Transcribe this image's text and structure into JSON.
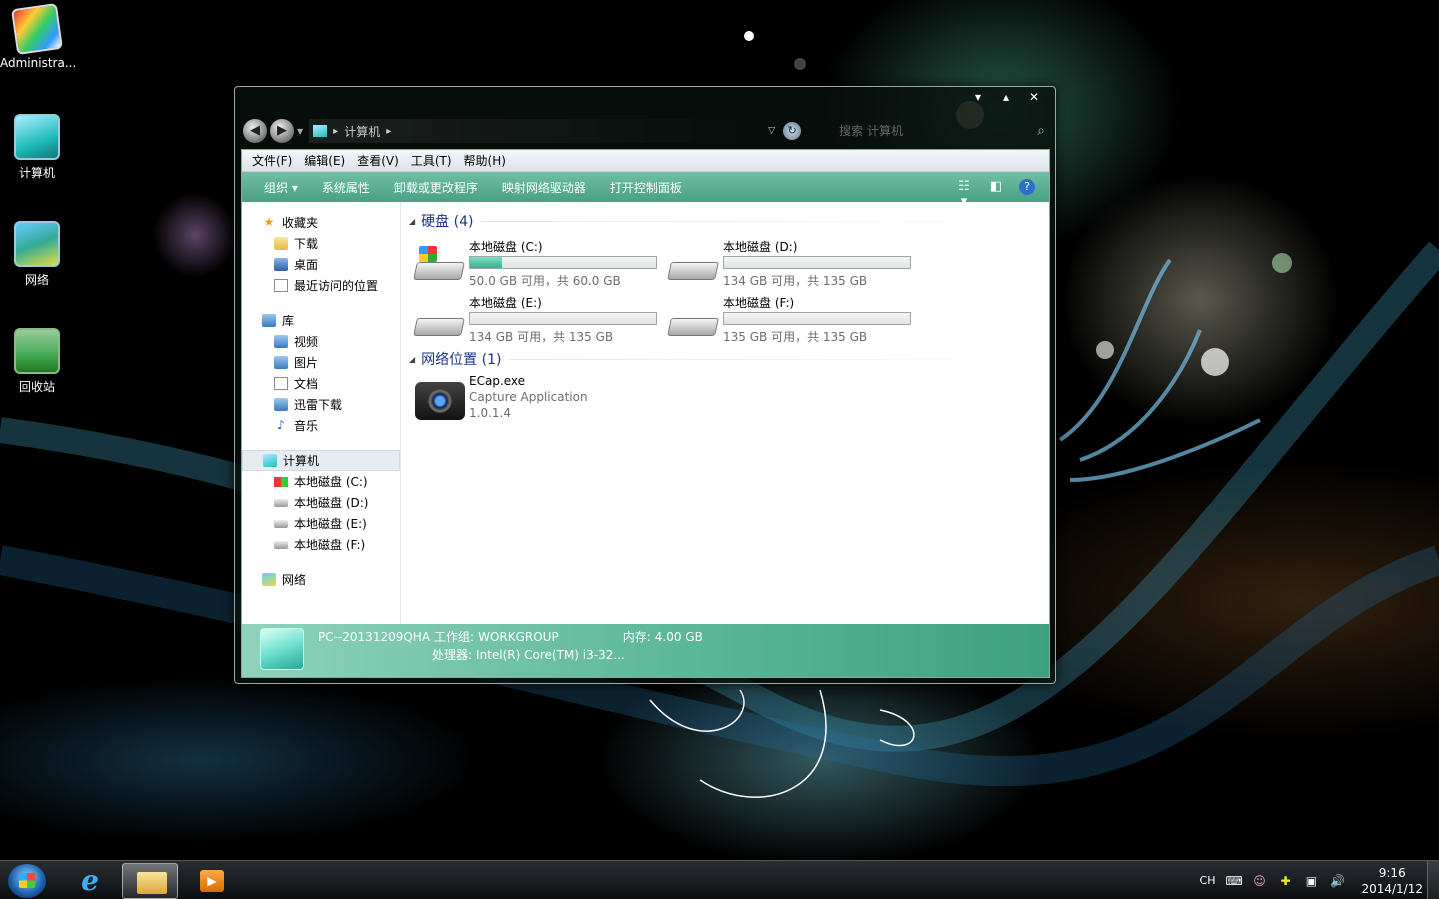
{
  "desktop": {
    "icons": [
      {
        "label": "Administra...",
        "icon": "user-folder-icon"
      },
      {
        "label": "计算机",
        "icon": "computer-icon"
      },
      {
        "label": "网络",
        "icon": "network-icon"
      },
      {
        "label": "回收站",
        "icon": "recycle-bin-icon"
      }
    ]
  },
  "window": {
    "controls": {
      "minimize": "▾",
      "maximize": "▴",
      "close": "✕"
    },
    "address": {
      "crumb": "计算机",
      "separator": "▸"
    },
    "search": {
      "placeholder": "搜索 计算机"
    },
    "menubar": [
      "文件(F)",
      "编辑(E)",
      "查看(V)",
      "工具(T)",
      "帮助(H)"
    ],
    "toolbar": {
      "organize": "组织 ▾",
      "items": [
        "系统属性",
        "卸载或更改程序",
        "映射网络驱动器",
        "打开控制面板"
      ]
    },
    "nav": {
      "favorites": {
        "label": "收藏夹",
        "items": [
          "下载",
          "桌面",
          "最近访问的位置"
        ]
      },
      "libraries": {
        "label": "库",
        "items": [
          "视频",
          "图片",
          "文档",
          "迅雷下载",
          "音乐"
        ]
      },
      "computer": {
        "label": "计算机",
        "items": [
          "本地磁盘 (C:)",
          "本地磁盘 (D:)",
          "本地磁盘 (E:)",
          "本地磁盘 (F:)"
        ]
      },
      "network": {
        "label": "网络"
      }
    },
    "content": {
      "hard_disks_header": "硬盘 (4)",
      "drives": [
        {
          "name": "本地磁盘 (C:)",
          "info": "50.0 GB 可用，共 60.0 GB",
          "used_fraction": 0.17,
          "system": true
        },
        {
          "name": "本地磁盘 (D:)",
          "info": "134 GB 可用，共 135 GB",
          "used_fraction": 0.0,
          "system": false
        },
        {
          "name": "本地磁盘 (E:)",
          "info": "134 GB 可用，共 135 GB",
          "used_fraction": 0.0,
          "system": false
        },
        {
          "name": "本地磁盘 (F:)",
          "info": "135 GB 可用，共 135 GB",
          "used_fraction": 0.0,
          "system": false
        }
      ],
      "network_header": "网络位置 (1)",
      "app": {
        "name": "ECap.exe",
        "description": "Capture Application",
        "version": "1.0.1.4"
      }
    },
    "details": {
      "computer_name": "PC--20131209QHA",
      "workgroup_label": "工作组:",
      "workgroup": "WORKGROUP",
      "memory_label": "内存:",
      "memory": "4.00 GB",
      "processor_label": "处理器:",
      "processor": "Intel(R) Core(TM) i3-32..."
    }
  },
  "taskbar": {
    "language": "CH",
    "time": "9:16",
    "date": "2014/1/12"
  },
  "colors": {
    "toolbar": "#4a9f86",
    "details_pane": "#57b595",
    "group_header": "#1e3287",
    "bar_fill": "#36b08c"
  }
}
